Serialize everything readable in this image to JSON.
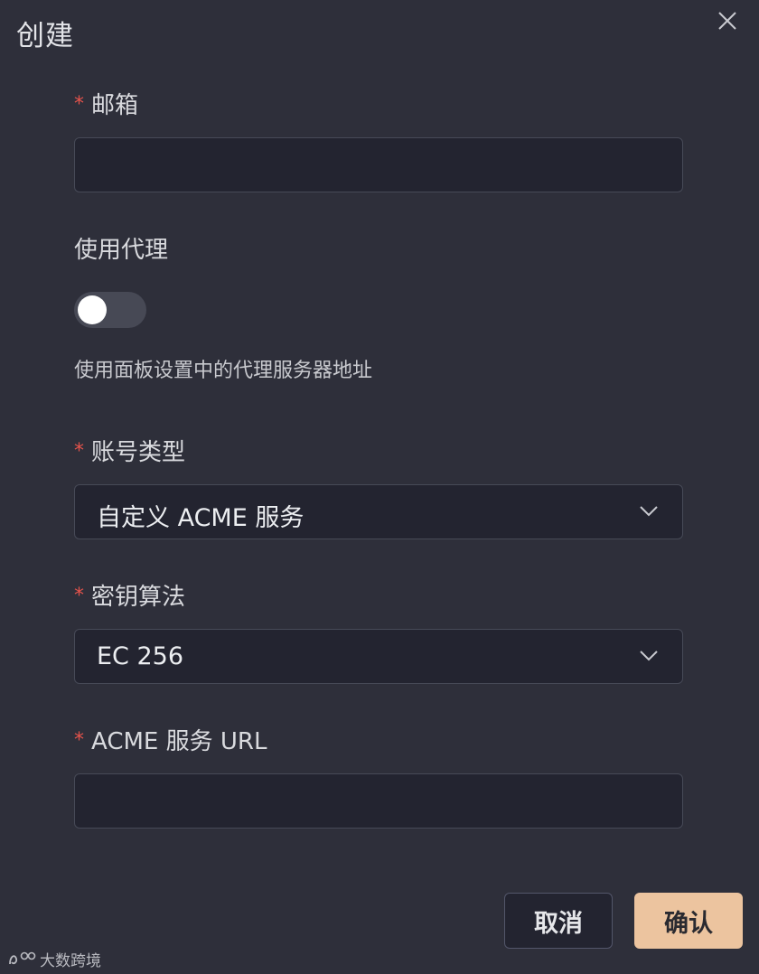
{
  "dialog": {
    "title": "创建",
    "close_icon": "close-icon"
  },
  "fields": {
    "email": {
      "required_mark": "*",
      "label": "邮箱",
      "value": "",
      "placeholder": ""
    },
    "use_proxy": {
      "label": "使用代理",
      "enabled": false,
      "hint": "使用面板设置中的代理服务器地址"
    },
    "account_type": {
      "required_mark": "*",
      "label": "账号类型",
      "value": "自定义 ACME 服务",
      "icon": "chevron-down-icon"
    },
    "key_algorithm": {
      "required_mark": "*",
      "label": "密钥算法",
      "value": "EC 256",
      "icon": "chevron-down-icon"
    },
    "acme_url": {
      "required_mark": "*",
      "label": "ACME 服务 URL",
      "value": "",
      "placeholder": ""
    }
  },
  "actions": {
    "cancel_label": "取消",
    "confirm_label": "确认"
  },
  "watermark": {
    "text": "大数跨境"
  },
  "colors": {
    "background": "#2e2f3a",
    "input_background": "#232430",
    "required": "#e5534b",
    "confirm_button": "#ecc49f",
    "toggle_off": "#474955"
  }
}
